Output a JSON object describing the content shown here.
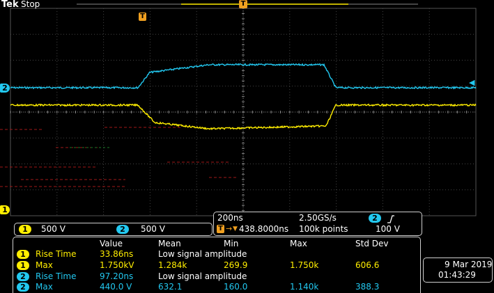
{
  "header": {
    "brand": "Tek",
    "status": "Stop"
  },
  "channels": [
    {
      "id": "1",
      "scale": "500 V",
      "color": "#ffee00"
    },
    {
      "id": "2",
      "scale": "500 V",
      "color": "#22c8f0"
    }
  ],
  "timebase": {
    "horizontal_scale": "200ns",
    "sample_rate": "2.50GS/s",
    "trigger_position": "438.8000ns",
    "record_length": "100k points",
    "trigger_source": "2",
    "trigger_level": "100 V"
  },
  "measurements": {
    "headers": [
      "Value",
      "Mean",
      "Min",
      "Max",
      "Std Dev"
    ],
    "rows": [
      {
        "ch": "1",
        "name": "Rise Time",
        "value": "33.86ns",
        "mean": "Low signal amplitude",
        "min": "",
        "max": "",
        "std": ""
      },
      {
        "ch": "1",
        "name": "Max",
        "value": "1.750kV",
        "mean": "1.284k",
        "min": "269.9",
        "max": "1.750k",
        "std": "606.6"
      },
      {
        "ch": "2",
        "name": "Rise Time",
        "value": "97.20ns",
        "mean": "Low signal amplitude",
        "min": "",
        "max": "",
        "std": ""
      },
      {
        "ch": "2",
        "name": "Max",
        "value": "440.0 V",
        "mean": "632.1",
        "min": "160.0",
        "max": "1.140k",
        "std": "388.3"
      }
    ]
  },
  "datetime": {
    "date": "9 Mar  2019",
    "time": "01:43:29"
  },
  "markers": {
    "trigger_glyph": "T",
    "ch1_marker": "1",
    "ch2_marker": "2"
  }
}
